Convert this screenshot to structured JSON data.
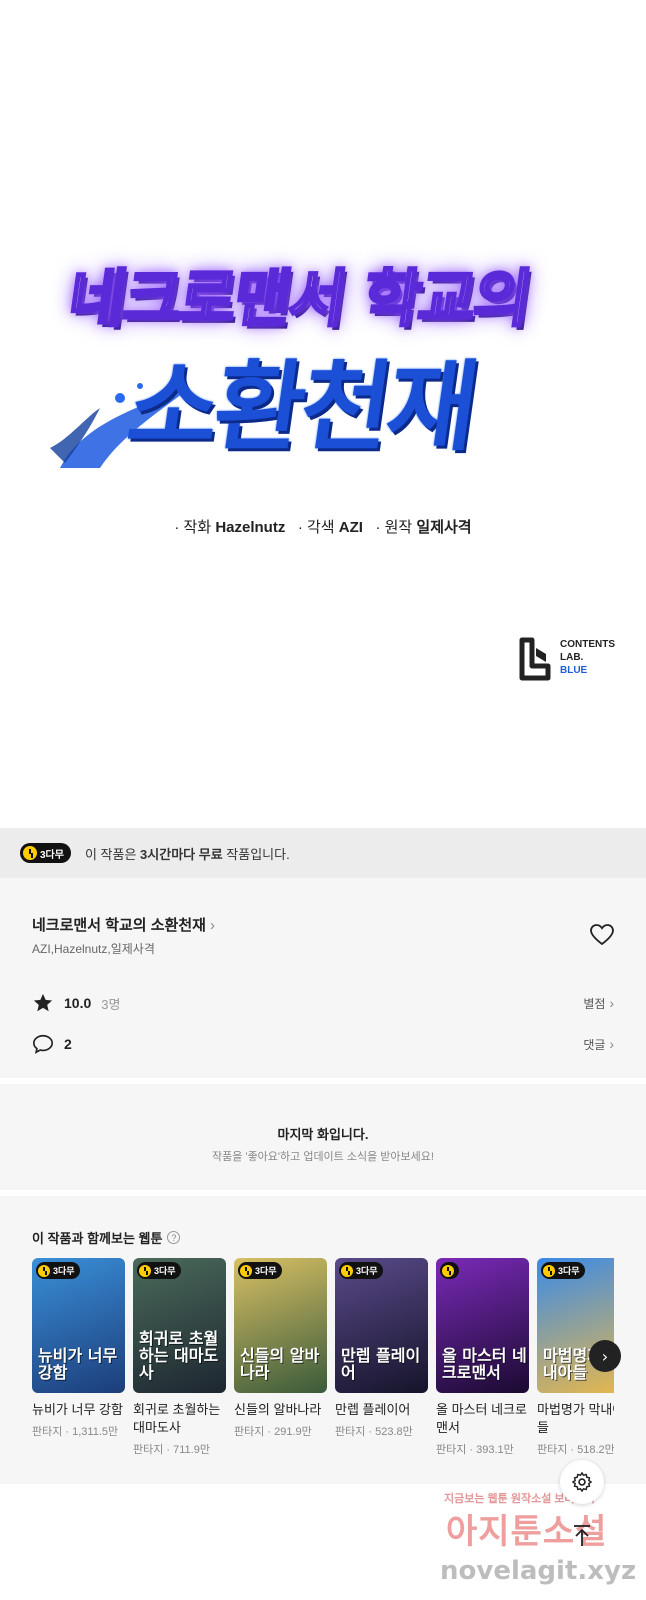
{
  "cover": {
    "title_line1": "네크로맨서 학교의",
    "title_line2": "소환천재",
    "credits": {
      "art_label": "· 작화",
      "art_name": "Hazelnutz",
      "adapt_label": "· 각색",
      "adapt_name": "AZI",
      "original_label": "· 원작",
      "original_name": "일제사격"
    },
    "publisher": [
      "CONTENTS",
      "LAB.",
      "BLUE"
    ]
  },
  "notice": {
    "badge": "3다무",
    "text_before": "이 작품은 ",
    "text_bold": "3시간마다 무료",
    "text_after": " 작품입니다."
  },
  "work": {
    "title": "네크로맨서 학교의 소환천재",
    "authors": "AZI,Hazelnutz,일제사격",
    "rating": "10.0",
    "rating_count": "3명",
    "rating_link": "별점",
    "comments": "2",
    "comments_link": "댓글"
  },
  "last_episode": {
    "title": "마지막 화입니다.",
    "subtitle": "작품을 '좋아요'하고 업데이트 소식을 받아보세요!"
  },
  "recommend": {
    "title": "이 작품과 함께보는 웹툰",
    "help": "?",
    "items": [
      {
        "name": "뉴비가 너무 강함",
        "genre": "판타지 · 1,311.5만",
        "badge": "3다무",
        "cover_text": "뉴비가 너무강함",
        "colors": [
          "#3a8fd8",
          "#1c3d7a"
        ]
      },
      {
        "name": "회귀로 초월하는 대마도사",
        "genre": "판타지 · 711.9만",
        "badge": "3다무",
        "cover_text": "회귀로 초월하는 대마도사",
        "colors": [
          "#4a6a5a",
          "#1d2630"
        ]
      },
      {
        "name": "신들의 알바나라",
        "genre": "판타지 · 291.9만",
        "badge": "3다무",
        "cover_text": "신들의 알바나라",
        "colors": [
          "#d8c064",
          "#3a5a3a"
        ]
      },
      {
        "name": "만렙 플레이어",
        "genre": "판타지 · 523.8만",
        "badge": "3다무",
        "cover_text": "만렙 플레이어",
        "colors": [
          "#5a4a8a",
          "#15142a"
        ]
      },
      {
        "name": "올 마스터 네크로맨서",
        "genre": "판타지 · 393.1만",
        "badge": "",
        "cover_text": "올 마스터 네크로맨서",
        "colors": [
          "#7a2ab8",
          "#1a0a30"
        ]
      },
      {
        "name": "마법명가 막내아들",
        "genre": "판타지 · 518.2만",
        "badge": "3다무",
        "cover_text": "마법명가 막내아들",
        "colors": [
          "#3a8ae8",
          "#e8b84a"
        ]
      }
    ]
  },
  "watermark": {
    "line1": "지금보는 웹툰 원작소설 보러가기",
    "line2": "아지툰소설",
    "line3": "novelagit.xyz"
  }
}
